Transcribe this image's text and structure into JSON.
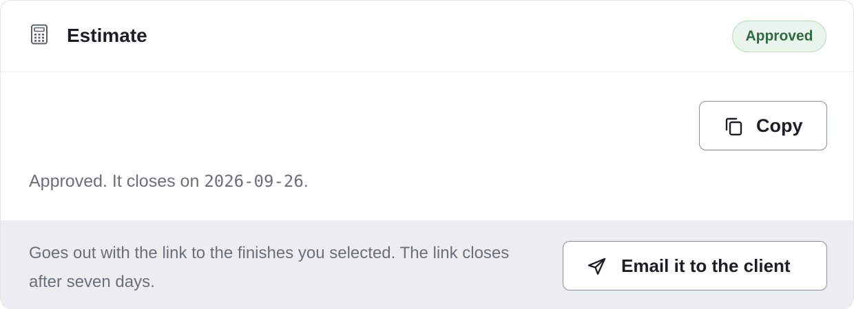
{
  "header": {
    "icon": "calculator-icon",
    "title": "Estimate",
    "status_badge": "Approved",
    "status_color": "#2e6b40",
    "status_bg": "#eaf4ec"
  },
  "actions": {
    "copy_icon": "copy-icon",
    "copy_label": "Copy"
  },
  "status": {
    "text_prefix": "Approved. It closes on ",
    "close_date": "2026-09-26",
    "text_suffix": "."
  },
  "footer": {
    "note": "Goes out with the link to the finishes you selected. The link closes after seven days.",
    "email_icon": "send-icon",
    "email_label": "Email it to the client"
  }
}
